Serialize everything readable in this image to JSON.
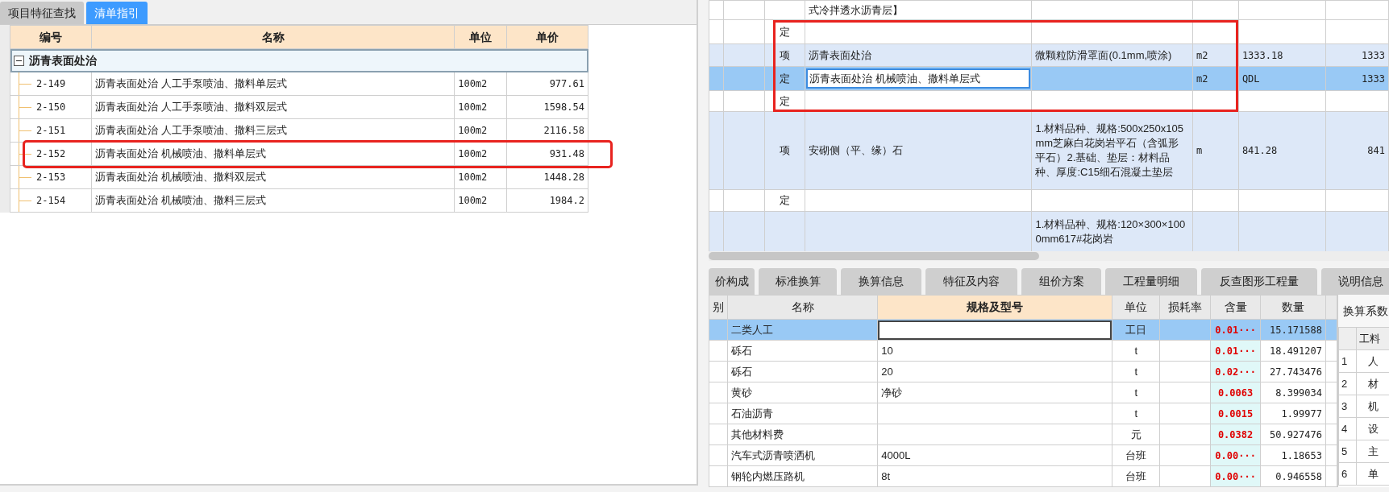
{
  "left_panel": {
    "tabs": [
      {
        "label": "项目特征查找",
        "selected": false
      },
      {
        "label": "清单指引",
        "selected": true
      }
    ],
    "table": {
      "columns": [
        "编号",
        "名称",
        "单位",
        "单价"
      ],
      "group": {
        "label": "沥青表面处治",
        "expanded": true
      },
      "rows": [
        {
          "code": "2-149",
          "name": "沥青表面处治 人工手泵喷油、撒料单层式",
          "unit": "100m2",
          "price": "977.61",
          "highlighted": false
        },
        {
          "code": "2-150",
          "name": "沥青表面处治 人工手泵喷油、撒料双层式",
          "unit": "100m2",
          "price": "1598.54",
          "highlighted": false
        },
        {
          "code": "2-151",
          "name": "沥青表面处治 人工手泵喷油、撒料三层式",
          "unit": "100m2",
          "price": "2116.58",
          "highlighted": false
        },
        {
          "code": "2-152",
          "name": "沥青表面处治 机械喷油、撒料单层式",
          "unit": "100m2",
          "price": "931.48",
          "highlighted": true
        },
        {
          "code": "2-153",
          "name": "沥青表面处治 机械喷油、撒料双层式",
          "unit": "100m2",
          "price": "1448.28",
          "highlighted": false
        },
        {
          "code": "2-154",
          "name": "沥青表面处治 机械喷油、撒料三层式",
          "unit": "100m2",
          "price": "1984.2",
          "highlighted": false
        }
      ]
    }
  },
  "right_panel": {
    "quota_table": {
      "rows": [
        {
          "kind": "quota",
          "type": "",
          "name": "式冷拌透水沥青层】",
          "spec": "",
          "unit": "",
          "quantity_expr": "",
          "column_8": "",
          "selected": false,
          "framed": false
        },
        {
          "kind": "quota",
          "type": "定",
          "name": "",
          "spec": "",
          "unit": "",
          "quantity_expr": "",
          "column_8": "",
          "selected": false,
          "framed": true
        },
        {
          "kind": "item",
          "type": "项",
          "name": "沥青表面处治",
          "spec": "微颗粒防滑罩面(0.1mm,喷涂)",
          "unit": "m2",
          "quantity_expr": "1333.18",
          "column_8": "1333",
          "selected": false,
          "framed": true
        },
        {
          "kind": "quota",
          "type": "定",
          "name": "沥青表面处治 机械喷油、撒料单层式",
          "spec": "",
          "unit": "m2",
          "quantity_expr": "QDL",
          "column_8": "1333",
          "selected": true,
          "framed": true
        },
        {
          "kind": "quota",
          "type": "定",
          "name": "",
          "spec": "",
          "unit": "",
          "quantity_expr": "",
          "column_8": "",
          "selected": false,
          "framed": true
        },
        {
          "kind": "item",
          "type": "项",
          "name": "安砌侧（平、缘）石",
          "spec": "1.材料品种、规格:500x250x105mm芝麻白花岗岩平石（含弧形平石）2.基础、垫层：材料品种、厚度:C15细石混凝土垫层",
          "unit": "m",
          "quantity_expr": "841.28",
          "column_8": "841",
          "selected": false,
          "framed": false
        },
        {
          "kind": "quota",
          "type": "定",
          "name": "",
          "spec": "",
          "unit": "",
          "quantity_expr": "",
          "column_8": "",
          "selected": false,
          "framed": false
        },
        {
          "kind": "item",
          "type": "",
          "name": "",
          "spec": "1.材料品种、规格:120×300×1000mm617#花岗岩",
          "unit": "",
          "quantity_expr": "",
          "column_8": "",
          "selected": false,
          "framed": false
        }
      ]
    },
    "tabs": [
      {
        "label": "价构成"
      },
      {
        "label": "标准换算"
      },
      {
        "label": "换算信息"
      },
      {
        "label": "特征及内容"
      },
      {
        "label": "组价方案"
      },
      {
        "label": "工程量明细"
      },
      {
        "label": "反查图形工程量"
      },
      {
        "label": "说明信息"
      }
    ],
    "resource_grid": {
      "columns": [
        "别",
        "名称",
        "规格及型号",
        "单位",
        "损耗率",
        "含量",
        "数量",
        ""
      ],
      "rows": [
        {
          "name": "二类人工",
          "spec": "",
          "unit": "工日",
          "content": "0.01···",
          "quantity": "15.171588",
          "selected": true
        },
        {
          "name": "砾石",
          "spec": "10",
          "unit": "t",
          "content": "0.01···",
          "quantity": "18.491207",
          "selected": false
        },
        {
          "name": "砾石",
          "spec": "20",
          "unit": "t",
          "content": "0.02···",
          "quantity": "27.743476",
          "selected": false
        },
        {
          "name": "黄砂",
          "spec": "净砂",
          "unit": "t",
          "content": "0.0063",
          "quantity": "8.399034",
          "selected": false
        },
        {
          "name": "石油沥青",
          "spec": "",
          "unit": "t",
          "content": "0.0015",
          "quantity": "1.99977",
          "selected": false
        },
        {
          "name": "其他材料费",
          "spec": "",
          "unit": "元",
          "content": "0.0382",
          "quantity": "50.927476",
          "selected": false
        },
        {
          "name": "汽车式沥青喷洒机",
          "spec": "4000L",
          "unit": "台班",
          "content": "0.00···",
          "quantity": "1.18653",
          "selected": false
        },
        {
          "name": "钢轮内燃压路机",
          "spec": "8t",
          "unit": "台班",
          "content": "0.00···",
          "quantity": "0.946558",
          "selected": false
        }
      ]
    },
    "conversion_panel": {
      "title": "换算系数",
      "header": "工料",
      "rows": [
        {
          "index": "1",
          "label": "人"
        },
        {
          "index": "2",
          "label": "材"
        },
        {
          "index": "3",
          "label": "机"
        },
        {
          "index": "4",
          "label": "设"
        },
        {
          "index": "5",
          "label": "主"
        },
        {
          "index": "6",
          "label": "单"
        }
      ]
    }
  }
}
